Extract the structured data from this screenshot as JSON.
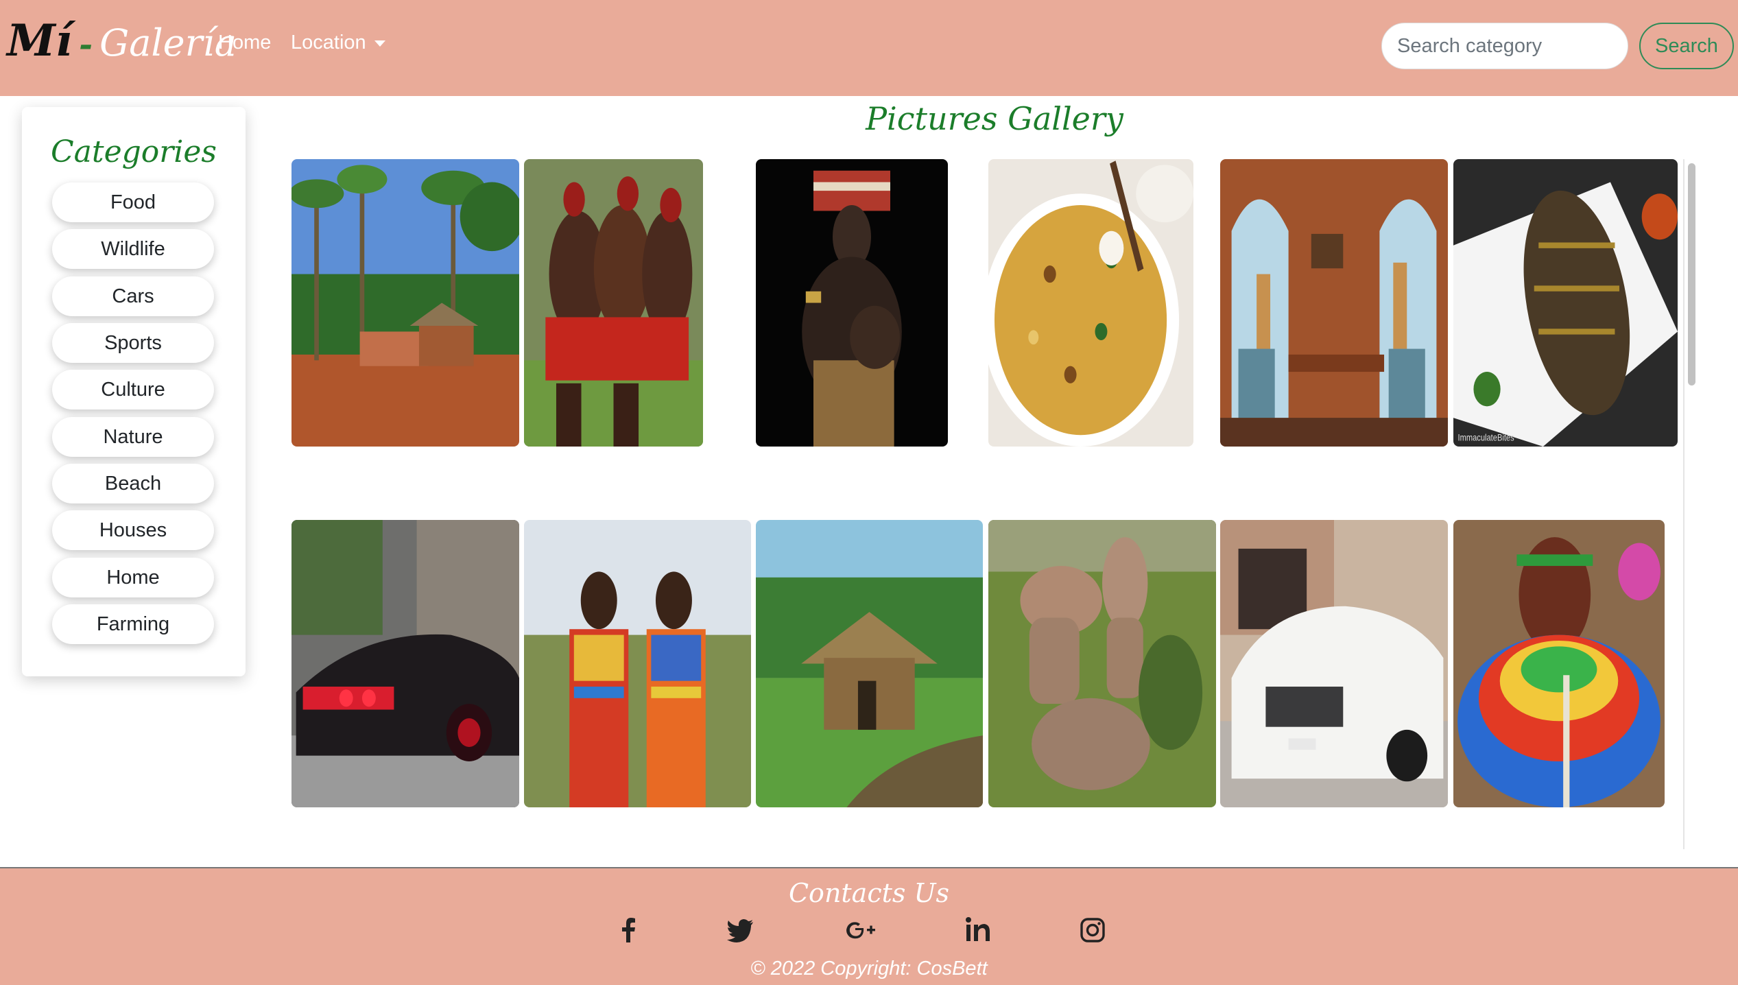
{
  "brand": {
    "part1": "Mí",
    "dash": "-",
    "part2": "Galería"
  },
  "nav": {
    "home": "Home",
    "location": "Location"
  },
  "search": {
    "placeholder": "Search category",
    "button": "Search"
  },
  "sidebar": {
    "title": "Categories",
    "items": [
      "Food",
      "Wildlife",
      "Cars",
      "Sports",
      "Culture",
      "Nature",
      "Beach",
      "Houses",
      "Home",
      "Farming"
    ]
  },
  "gallery": {
    "title": "Pictures Gallery",
    "photos": [
      "village-palm-trees-photo",
      "maasai-warriors-dancing-photo",
      "woman-with-child-photo",
      "rice-pilau-dish-photo",
      "giraffes-dining-room-photo",
      "fried-fish-photo",
      "muscle-car-photo",
      "maasai-girls-photo",
      "grass-hut-photo",
      "rock-formation-photo",
      "white-suv-photo",
      "maasai-woman-beads-photo"
    ],
    "watermark": "ImmaculateBites"
  },
  "footer": {
    "title": "Contacts Us",
    "social": [
      "facebook-icon",
      "twitter-icon",
      "google-plus-icon",
      "linkedin-icon",
      "instagram-icon"
    ],
    "copyright": "© 2022 Copyright: CosBett"
  },
  "colors": {
    "accent": "#e9ab99",
    "heading": "#1b7d2a",
    "search": "#2e8b57"
  }
}
